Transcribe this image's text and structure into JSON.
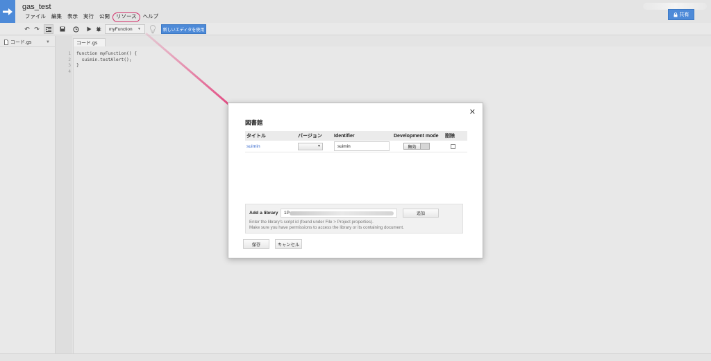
{
  "header": {
    "title": "gas_test",
    "menu": [
      "ファイル",
      "編集",
      "表示",
      "実行",
      "公開",
      "リソース",
      "ヘルプ"
    ],
    "share_label": "共有"
  },
  "toolbar": {
    "function_select": "myFunction",
    "new_editor_label": "新しいエディタを使用"
  },
  "sidebar": {
    "file_label": "コード.gs"
  },
  "editor": {
    "tab_label": "コード.gs",
    "line_numbers": "1\n2\n3\n4",
    "code": "function myFunction() {\n  suimin.testAlert();\n}"
  },
  "dialog": {
    "title": "図書館",
    "columns": {
      "title": "タイトル",
      "version": "バージョン",
      "identifier": "Identifier",
      "devmode": "Development mode",
      "delete": "削除"
    },
    "library": {
      "name": "suimin",
      "identifier": "suimin",
      "devmode": "無効"
    },
    "add": {
      "label": "Add a library",
      "input_value": "1P",
      "button": "追加",
      "hint1": "Enter the library's script id (found under File > Project properties).",
      "hint2": "Make sure you have permissions to access the library or its containing document."
    },
    "save_label": "保存",
    "cancel_label": "キャンセル"
  },
  "colors": {
    "accent": "#4d8ad8",
    "highlight": "#d4306a",
    "link": "#3366cc"
  }
}
